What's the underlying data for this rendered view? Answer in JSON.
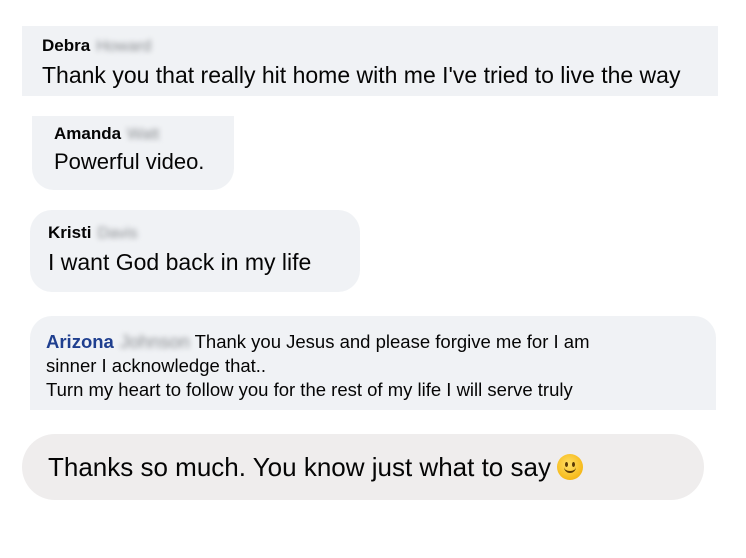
{
  "comments": [
    {
      "first_name": "Debra",
      "last_name": "Howard",
      "text": "Thank you that really hit home with me I've tried to live the way"
    },
    {
      "first_name": "Amanda",
      "last_name": "Watt",
      "text": "Powerful video."
    },
    {
      "first_name": "Kristi",
      "last_name": "Davis",
      "text": "I want God back in my life"
    },
    {
      "first_name": "Arizona",
      "last_name": "Johnson",
      "text_line1": "Thank you Jesus and please forgive me for I am",
      "text_line2": "sinner I acknowledge that..",
      "text_line3": "Turn my heart to follow you for the rest of my life I will serve truly"
    }
  ],
  "reply": {
    "text": "Thanks so much. You know just what to say",
    "emoji": "smiling-face-icon"
  },
  "colors": {
    "bubble": "#f0f2f5",
    "name_link": "#1f3f8f",
    "text": "#050505"
  }
}
